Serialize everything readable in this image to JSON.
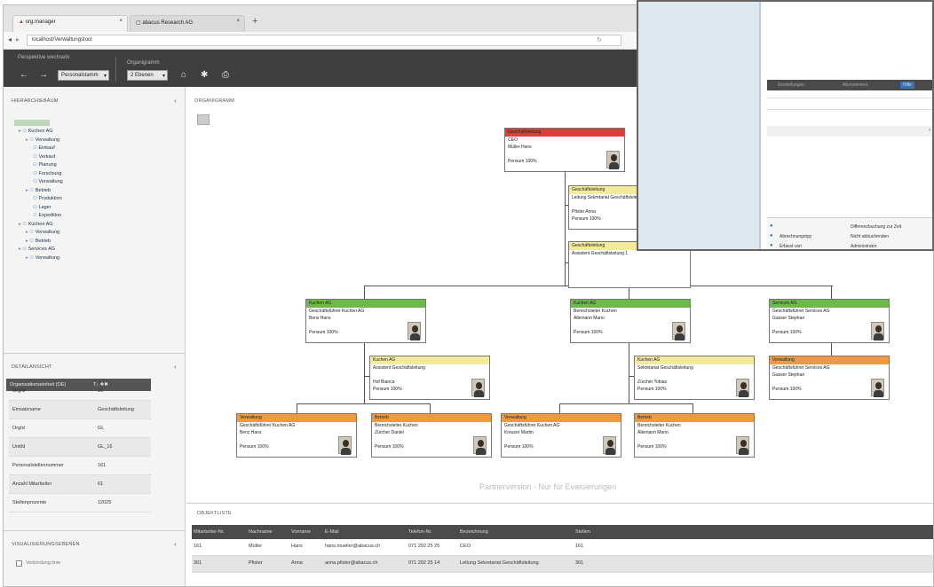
{
  "browser": {
    "tabs": [
      {
        "label": "org.manager"
      },
      {
        "label": "abacus Research AG"
      }
    ],
    "url": "localhost/Verwaltungstool"
  },
  "toolbar": {
    "perspective_label": "Perspektive wechseln",
    "perspective_value": "Personalstamm",
    "level_label": "Organigramm",
    "level_value": "2 Ebenen"
  },
  "left": {
    "tree_title": "HIERARCHIEBAUM",
    "tree": [
      {
        "label": "Kuchen AG",
        "depth": 0
      },
      {
        "label": "Verwaltung",
        "depth": 1
      },
      {
        "label": "Einkauf",
        "depth": 2
      },
      {
        "label": "Verkauf",
        "depth": 2
      },
      {
        "label": "Planung",
        "depth": 2
      },
      {
        "label": "Forschung",
        "depth": 2
      },
      {
        "label": "Verwaltung",
        "depth": 2
      },
      {
        "label": "Betrieb",
        "depth": 1
      },
      {
        "label": "Produktion",
        "depth": 2
      },
      {
        "label": "Lager",
        "depth": 2
      },
      {
        "label": "Expedition",
        "depth": 2
      },
      {
        "label": "Kuchen AG",
        "depth": 0
      },
      {
        "label": "Verwaltung",
        "depth": 1
      },
      {
        "label": "Betrieb",
        "depth": 1
      },
      {
        "label": "Services AG",
        "depth": 0
      },
      {
        "label": "Verwaltung",
        "depth": 1
      }
    ],
    "detail_title": "DETAILANSICHT",
    "detail_header": "Organisationseinheit (OE)",
    "detail_rows": [
      {
        "k": "OrgNr",
        "v": "16"
      },
      {
        "k": "Einsatzname",
        "v": "Geschäftsleitung"
      },
      {
        "k": "OrgId",
        "v": "GL"
      },
      {
        "k": "UnitId",
        "v": "GL_16"
      },
      {
        "k": "Personalstellennummer",
        "v": "161"
      },
      {
        "k": "Anzahl Mitarbeiter",
        "v": "61"
      },
      {
        "k": "Stellenprozente",
        "v": "12025"
      }
    ],
    "visual_title": "VISUALISIERUNGSEBENEN",
    "checkbox_label": "Verbindung linie"
  },
  "org": {
    "title": "ORGANIGRAMM",
    "watermark": "Partnerversion - Nur für Evaluierungen",
    "nodes": [
      {
        "id": "ceo",
        "header": "Geschäftsleitung",
        "color": "#d9403c",
        "lines": [
          "CEO",
          "Müller Hans",
          "",
          "Pensum 100%"
        ],
        "photo": true
      },
      {
        "id": "staff1",
        "header": "Geschäftsleitung",
        "color": "#f3eb9b",
        "lines": [
          "Leitung Sekretariat Geschäftsleitung",
          "",
          "Pfister Anna",
          "Pensum 100%"
        ],
        "photo": false
      },
      {
        "id": "staff2",
        "header": "Geschäftsleitung",
        "color": "#f3eb9b",
        "lines": [
          "Assistent Geschäftsleitung 1"
        ],
        "photo": false
      },
      {
        "id": "k1",
        "header": "Kuchen AG",
        "color": "#6cbb4a",
        "lines": [
          "Geschäftsführer Kuchen AG",
          "Benz Hans",
          "",
          "Pensum 100%"
        ],
        "photo": true
      },
      {
        "id": "k2",
        "header": "Kuchen AG",
        "color": "#6cbb4a",
        "lines": [
          "Bereichsleiter Kuchen",
          "Allemann Mario",
          "",
          "Pensum 100%"
        ],
        "photo": true
      },
      {
        "id": "sv",
        "header": "Services AG",
        "color": "#6cbb4a",
        "lines": [
          "Geschäftsführer Services AG",
          "Gasser Stephan",
          "",
          "Pensum 100%"
        ],
        "photo": true
      },
      {
        "id": "k1a",
        "header": "Kuchen AG",
        "color": "#f3eb9b",
        "lines": [
          "Assistent Geschäftsleitung",
          "",
          "Hof Bianca",
          "Pensum 100%"
        ],
        "photo": true
      },
      {
        "id": "k2a",
        "header": "Kuchen AG",
        "color": "#f3eb9b",
        "lines": [
          "Sekretariat Geschäftsleitung",
          "",
          "Zürcher Tobias",
          "Pensum 100%"
        ],
        "photo": true
      },
      {
        "id": "svv",
        "header": "Verwaltung",
        "color": "#ef9a3c",
        "lines": [
          "Geschäftsführer Services AG",
          "Gasser Stephan",
          "",
          "Pensum 100%"
        ],
        "photo": true
      },
      {
        "id": "v1",
        "header": "Verwaltung",
        "color": "#ef9a3c",
        "lines": [
          "Geschäftsführer Kuchen AG",
          "Benz Hans",
          "",
          "Pensum 100%"
        ],
        "photo": true
      },
      {
        "id": "b1",
        "header": "Betrieb",
        "color": "#ef9a3c",
        "lines": [
          "Bereichsleiter Kuchen",
          "Zürcher Daniel",
          "",
          "Pensum 100%"
        ],
        "photo": true
      },
      {
        "id": "v2",
        "header": "Verwaltung",
        "color": "#ef9a3c",
        "lines": [
          "Geschäftsführer Kuchen AG",
          "Kreuzer Martin",
          "",
          "Pensum 100%"
        ],
        "photo": true
      },
      {
        "id": "b2",
        "header": "Betrieb",
        "color": "#ef9a3c",
        "lines": [
          "Bereichsleiter Kuchen",
          "Allemann Mario",
          "",
          "Pensum 100%"
        ],
        "photo": true
      }
    ]
  },
  "list": {
    "title": "OBJEKTLISTE",
    "columns": [
      "Mitarbeiter-Nr.",
      "Nachname",
      "Vorname",
      "E-Mail",
      "Telefon-Nr.",
      "Bezeichnung",
      "Stellen"
    ],
    "rows": [
      [
        "161",
        "Müller",
        "Hans",
        "hans.mueller@abacus.ch",
        "071 292 25 25",
        "CEO",
        "161"
      ],
      [
        "301",
        "Pfister",
        "Anna",
        "anna.pfister@abacus.ch",
        "071 292 25 14",
        "Leitung Sekretariat Geschäftsleitung",
        "301"
      ]
    ]
  },
  "overlay": {
    "tabs": [
      "Einstellungen",
      "Abonnement",
      "Hilfe"
    ],
    "rows": [
      {
        "left": "",
        "right": "Differenzbuchung zur Zeit"
      },
      {
        "left": "Abrechnungstyp",
        "right": "Nicht abbuchenden"
      },
      {
        "left": "Erfasst von",
        "right": "Administrator"
      }
    ]
  }
}
